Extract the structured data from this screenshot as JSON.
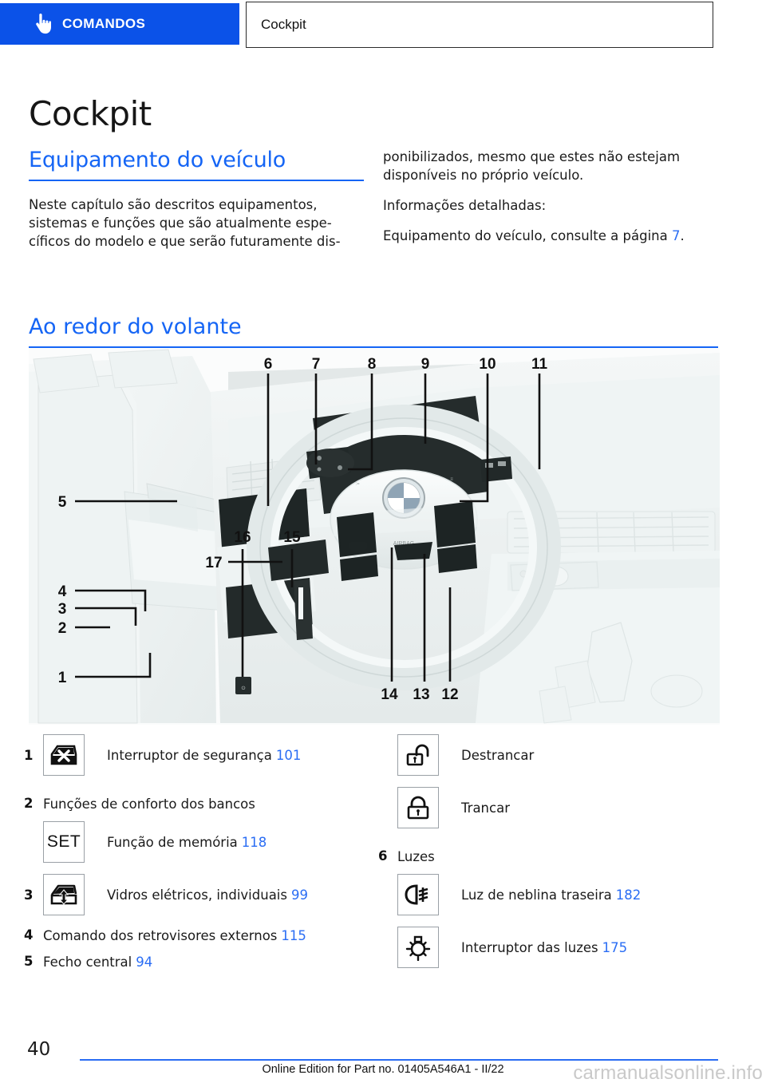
{
  "header": {
    "tab_label": "COMANDOS",
    "tab_icon": "pointing-hand-icon",
    "breadcrumb": "Cockpit",
    "tab_color": "#0b52e8"
  },
  "page_title": "Cockpit",
  "sections": {
    "equipment": {
      "heading": "Equipamento do veículo",
      "left_paragraph": "Neste capítulo são descritos equipamentos, sistemas e funções que são atualmente espe-cíficos do modelo e que serão futuramente dis-",
      "right_paragraph_1": "ponibilizados, mesmo que estes não estejam disponíveis no próprio veículo.",
      "right_paragraph_2": "Informações detalhadas:",
      "right_paragraph_3_prefix": "Equipamento do veículo, consulte a página ",
      "right_paragraph_3_page": "7",
      "right_paragraph_3_suffix": "."
    },
    "steering": {
      "heading": "Ao redor do volante"
    }
  },
  "diagram": {
    "name": "cockpit-driver-side-illustration",
    "callouts": [
      "1",
      "2",
      "3",
      "4",
      "5",
      "6",
      "7",
      "8",
      "9",
      "10",
      "11",
      "12",
      "13",
      "14",
      "15",
      "16",
      "17"
    ]
  },
  "legend_left": [
    {
      "num": "1",
      "icon": "window-safety-switch-icon",
      "label": "Interruptor de segurança",
      "page": "101"
    },
    {
      "num": "2",
      "label": "Funções de conforto dos bancos",
      "sub": [
        {
          "icon": "set-memory-icon",
          "icon_text": "SET",
          "label": "Função de memória",
          "page": "118"
        }
      ]
    },
    {
      "num": "3",
      "icon": "power-window-icon",
      "label": "Vidros elétricos, individuais",
      "page": "99"
    },
    {
      "num": "4",
      "label": "Comando dos retrovisores externos",
      "page": "115"
    },
    {
      "num": "5",
      "label": "Fecho central",
      "page": "94"
    }
  ],
  "legend_right": [
    {
      "icon": "unlock-icon",
      "label": "Destrancar"
    },
    {
      "icon": "lock-icon",
      "label": "Trancar"
    },
    {
      "num": "6",
      "label": "Luzes",
      "sub": [
        {
          "icon": "rear-fog-light-icon",
          "label": "Luz de neblina traseira",
          "page": "182"
        },
        {
          "icon": "light-switch-icon",
          "label": "Interruptor das luzes",
          "page": "175"
        }
      ]
    }
  ],
  "footer": {
    "page_number": "40",
    "edition": "Online Edition for Part no. 01405A546A1 - II/22",
    "watermark": "carmanualsonline.info",
    "rule_color": "#2a6df4"
  }
}
